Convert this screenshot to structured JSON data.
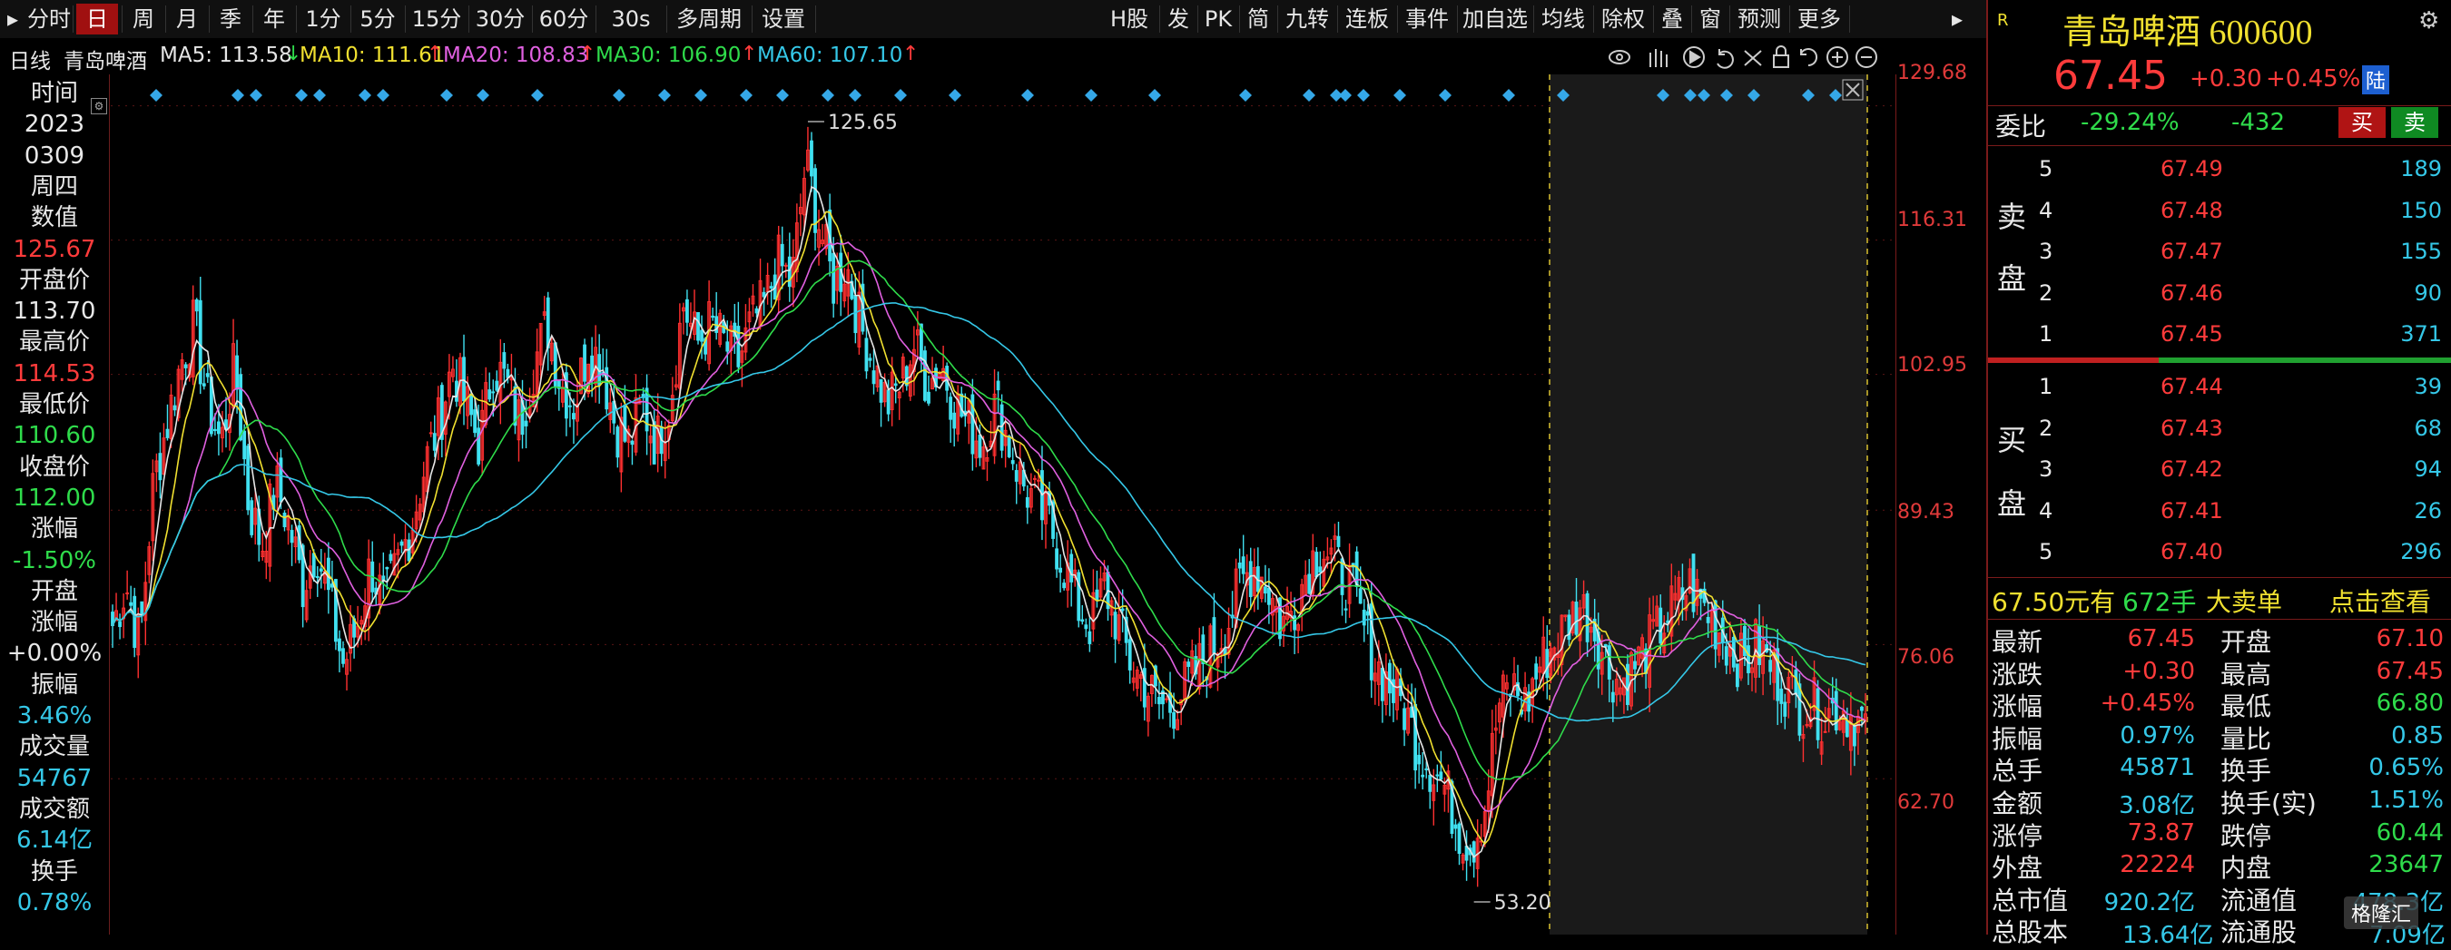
{
  "toolbar": {
    "left_items": [
      "分时",
      "日",
      "周",
      "月",
      "季",
      "年",
      "1分",
      "5分",
      "15分",
      "30分",
      "60分",
      "30s",
      "多周期",
      "设置"
    ],
    "active": "日",
    "right_items": [
      "H股",
      "发",
      "PK",
      "简",
      "九转",
      "连板",
      "事件",
      "加自选",
      "均线",
      "除权",
      "叠",
      "窗",
      "预测",
      "更多"
    ]
  },
  "ma_row": {
    "period": "日线",
    "stock_name": "青岛啤酒",
    "ma": [
      {
        "label": "MA5: 113.58",
        "arrow": "↓",
        "color": "#e6e6e6",
        "arrow_color": "#2fdc4b"
      },
      {
        "label": "MA10: 111.61",
        "arrow": "↑",
        "color": "#f0e030",
        "arrow_color": "#ff3b3b"
      },
      {
        "label": "MA20: 108.83",
        "arrow": "↑",
        "color": "#e060e0",
        "arrow_color": "#ff3b3b"
      },
      {
        "label": "MA30: 106.90",
        "arrow": "↑",
        "color": "#2fdc4b",
        "arrow_color": "#ff3b3b"
      },
      {
        "label": "MA60: 107.10",
        "arrow": "↑",
        "color": "#35c8e8",
        "arrow_color": "#ff3b3b"
      }
    ]
  },
  "info_panel": [
    {
      "text": "时间",
      "color": "#e8e8e8"
    },
    {
      "text": "2023",
      "color": "#e8e8e8"
    },
    {
      "text": "0309",
      "color": "#e8e8e8"
    },
    {
      "text": "周四",
      "color": "#e8e8e8"
    },
    {
      "text": "数值",
      "color": "#e8e8e8"
    },
    {
      "text": "125.67",
      "color": "#ff3b3b"
    },
    {
      "text": "开盘价",
      "color": "#e8e8e8"
    },
    {
      "text": "113.70",
      "color": "#e8e8e8"
    },
    {
      "text": "最高价",
      "color": "#e8e8e8"
    },
    {
      "text": "114.53",
      "color": "#ff3b3b"
    },
    {
      "text": "最低价",
      "color": "#e8e8e8"
    },
    {
      "text": "110.60",
      "color": "#2fdc4b"
    },
    {
      "text": "收盘价",
      "color": "#e8e8e8"
    },
    {
      "text": "112.00",
      "color": "#2fdc4b"
    },
    {
      "text": "涨幅",
      "color": "#e8e8e8"
    },
    {
      "text": "-1.50%",
      "color": "#2fdc4b"
    },
    {
      "text": "开盘",
      "color": "#e8e8e8"
    },
    {
      "text": "涨幅",
      "color": "#e8e8e8"
    },
    {
      "text": "+0.00%",
      "color": "#e8e8e8"
    },
    {
      "text": "振幅",
      "color": "#e8e8e8"
    },
    {
      "text": "3.46%",
      "color": "#35c8e8"
    },
    {
      "text": "成交量",
      "color": "#e8e8e8"
    },
    {
      "text": "54767",
      "color": "#35c8e8"
    },
    {
      "text": "成交额",
      "color": "#e8e8e8"
    },
    {
      "text": "6.14亿",
      "color": "#35c8e8"
    },
    {
      "text": "换手",
      "color": "#e8e8e8"
    },
    {
      "text": "0.78%",
      "color": "#35c8e8"
    }
  ],
  "chart_data": {
    "type": "candlestick",
    "y_axis_labels": [
      "129.68",
      "116.31",
      "102.95",
      "89.43",
      "76.06",
      "62.70"
    ],
    "ylim": [
      53.2,
      129.68
    ],
    "annotations": [
      {
        "text": "125.65",
        "kind": "max"
      },
      {
        "text": "53.20",
        "kind": "min"
      }
    ],
    "series_close": [
      78,
      82,
      76,
      92,
      98,
      104,
      108,
      100,
      96,
      104,
      90,
      86,
      92,
      88,
      82,
      86,
      80,
      74,
      78,
      84,
      80,
      84,
      88,
      94,
      98,
      104,
      100,
      96,
      104,
      102,
      98,
      104,
      108,
      102,
      100,
      106,
      104,
      98,
      96,
      100,
      96,
      100,
      110,
      106,
      108,
      106,
      104,
      108,
      110,
      114,
      112,
      124,
      118,
      112,
      114,
      108,
      104,
      100,
      102,
      106,
      102,
      104,
      100,
      98,
      96,
      100,
      96,
      92,
      90,
      88,
      84,
      80,
      78,
      82,
      78,
      74,
      72,
      70,
      70,
      72,
      74,
      76,
      78,
      82,
      84,
      82,
      78,
      80,
      84,
      86,
      84,
      82,
      78,
      74,
      72,
      70,
      66,
      64,
      62,
      58,
      56,
      60,
      70,
      72,
      70,
      74,
      76,
      78,
      80,
      78,
      74,
      72,
      74,
      76,
      78,
      80,
      82,
      80,
      78,
      76,
      74,
      76,
      74,
      72,
      70,
      70,
      69,
      70,
      69,
      68
    ]
  },
  "quote": {
    "title": "青岛啤酒 600600",
    "price": "67.45",
    "change": "+0.30",
    "change_pct": "+0.45%",
    "lu_badge": "陆",
    "wb_label": "委比",
    "wb_pct": "-29.24%",
    "wb_val": "-432",
    "buy_btn": "买",
    "sell_btn": "卖",
    "sell_label": [
      "卖",
      "盘"
    ],
    "buy_label": [
      "买",
      "盘"
    ],
    "sells": [
      {
        "lvl": "5",
        "price": "67.49",
        "vol": "189"
      },
      {
        "lvl": "4",
        "price": "67.48",
        "vol": "150"
      },
      {
        "lvl": "3",
        "price": "67.47",
        "vol": "155"
      },
      {
        "lvl": "2",
        "price": "67.46",
        "vol": "90"
      },
      {
        "lvl": "1",
        "price": "67.45",
        "vol": "371"
      }
    ],
    "buys": [
      {
        "lvl": "1",
        "price": "67.44",
        "vol": "39"
      },
      {
        "lvl": "2",
        "price": "67.43",
        "vol": "68"
      },
      {
        "lvl": "3",
        "price": "67.42",
        "vol": "94"
      },
      {
        "lvl": "4",
        "price": "67.41",
        "vol": "26"
      },
      {
        "lvl": "5",
        "price": "67.40",
        "vol": "296"
      }
    ],
    "bigorder": {
      "price": "67.50元有",
      "qty": "672手",
      "label": "大卖单",
      "link": "点击查看"
    },
    "stats": [
      {
        "l": "最新",
        "v": "67.45",
        "vc": "red",
        "l2": "开盘",
        "v2": "67.10",
        "vc2": "red"
      },
      {
        "l": "涨跌",
        "v": "+0.30",
        "vc": "red",
        "l2": "最高",
        "v2": "67.45",
        "vc2": "red"
      },
      {
        "l": "涨幅",
        "v": "+0.45%",
        "vc": "red",
        "l2": "最低",
        "v2": "66.80",
        "vc2": "green"
      },
      {
        "l": "振幅",
        "v": "0.97%",
        "vc": "cyan",
        "l2": "量比",
        "v2": "0.85",
        "vc2": "cyan"
      },
      {
        "l": "总手",
        "v": "45871",
        "vc": "cyan",
        "l2": "换手",
        "v2": "0.65%",
        "vc2": "cyan"
      },
      {
        "l": "金额",
        "v": "3.08亿",
        "vc": "cyan",
        "l2": "换手(实)",
        "v2": "1.51%",
        "vc2": "cyan"
      },
      {
        "l": "涨停",
        "v": "73.87",
        "vc": "red",
        "l2": "跌停",
        "v2": "60.44",
        "vc2": "green"
      },
      {
        "l": "外盘",
        "v": "22224",
        "vc": "red",
        "l2": "内盘",
        "v2": "23647",
        "vc2": "green"
      },
      {
        "l": "总市值",
        "v": "920.2亿",
        "vc": "cyan",
        "l2": "流通值",
        "v2": "478.3亿",
        "vc2": "cyan"
      }
    ],
    "last_row": {
      "l": "总股本",
      "v": "13.64亿",
      "l2": "流通股",
      "v2": "7.09亿"
    },
    "watermark": "格隆汇"
  }
}
